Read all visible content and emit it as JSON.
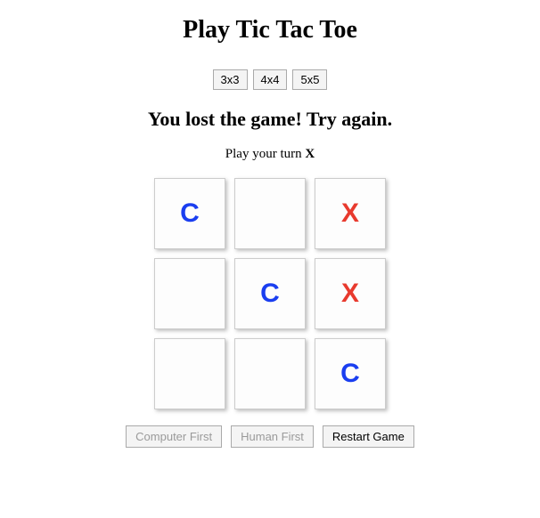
{
  "title": "Play Tic Tac Toe",
  "size_buttons": {
    "s3": "3x3",
    "s4": "4x4",
    "s5": "5x5"
  },
  "status": "You lost the game! Try again.",
  "turn": {
    "prefix": "Play your turn ",
    "mark": "X"
  },
  "board": {
    "cells": [
      "C",
      "",
      "X",
      "",
      "C",
      "X",
      "",
      "",
      "C"
    ]
  },
  "actions": {
    "computer_first": "Computer First",
    "human_first": "Human First",
    "restart": "Restart Game"
  },
  "colors": {
    "C": "#1a3ef0",
    "X": "#e83a2e"
  }
}
